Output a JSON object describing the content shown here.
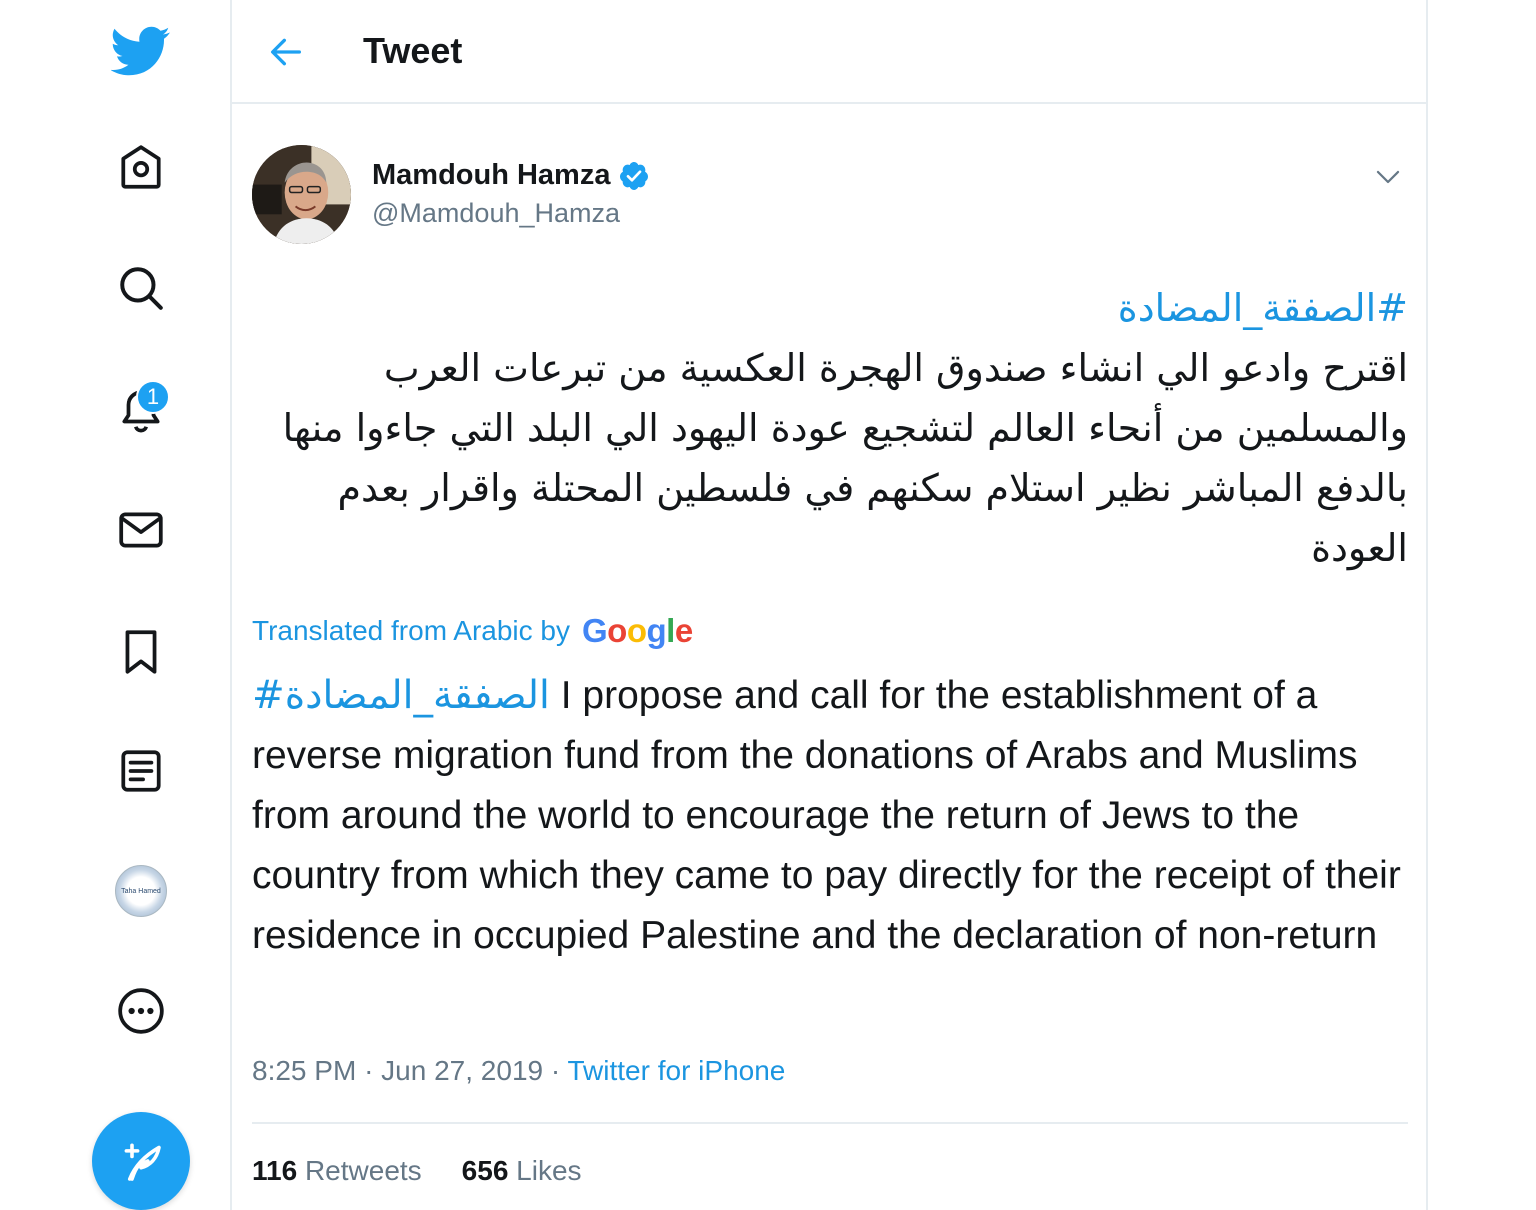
{
  "header": {
    "title": "Tweet"
  },
  "nav": {
    "notifications_badge": "1",
    "profile_thumb_text": "Taha Hamed"
  },
  "tweet": {
    "author": {
      "display_name": "Mamdouh Hamza",
      "handle": "@Mamdouh_Hamza"
    },
    "original": {
      "hashtag": "#الصفقة_المضادة",
      "text": "اقترح وادعو الي انشاء صندوق الهجرة العكسية من تبرعات العرب والمسلمين من أنحاء العالم لتشجيع عودة اليهود الي البلد التي جاءوا منها بالدفع المباشر نظير استلام سكنهم في فلسطين المحتلة واقرار بعدم العودة"
    },
    "translation": {
      "label": "Translated from Arabic by",
      "provider_letters": [
        "G",
        "o",
        "o",
        "g",
        "l",
        "e"
      ],
      "hashtag": "#الصفقة_المضادة",
      "text": "I propose and call for the establishment of a reverse migration fund from the donations of Arabs and Muslims from around the world to encourage the return of Jews to the country from which they came to pay directly for the receipt of their residence in occupied Palestine and the declaration of non-return"
    },
    "meta": {
      "time": "8:25 PM",
      "separator": "·",
      "date": "Jun 27, 2019",
      "source": "Twitter for iPhone"
    },
    "stats": {
      "retweets_count": "116",
      "retweets_label": "Retweets",
      "likes_count": "656",
      "likes_label": "Likes"
    }
  },
  "colors": {
    "accent": "#1da1f2",
    "link": "#1b95e0",
    "text": "#14171a",
    "secondary": "#657786",
    "border": "#e6ecf0"
  }
}
